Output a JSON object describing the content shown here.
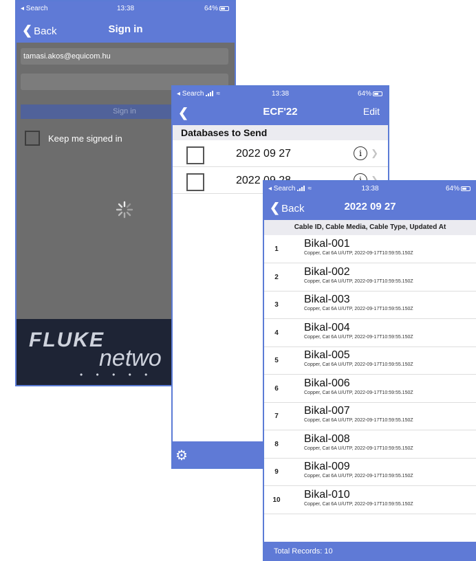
{
  "status": {
    "back": "◂ Search",
    "time": "13:38",
    "battery": "64%"
  },
  "signin": {
    "back": "Back",
    "title": "Sign in",
    "email": "tamasi.akos@equicom.hu",
    "password": "",
    "button": "Sign in",
    "keep": "Keep me signed in",
    "brand1": "FLUKE",
    "brand2": "netwo",
    "dots": "• • • • •"
  },
  "databases": {
    "title": "ECF'22",
    "edit": "Edit",
    "section": "Databases to Send",
    "rows": [
      {
        "name": "2022 09 27"
      },
      {
        "name": "2022 09 28"
      }
    ]
  },
  "records": {
    "back": "Back",
    "title": "2022 09 27",
    "header": "Cable ID, Cable Media, Cable Type, Updated At",
    "desc": "Copper, Cat 6A U/UTP, 2022-09-17T10:59:55.150Z",
    "items": [
      {
        "num": "1",
        "id": "Bikal-001"
      },
      {
        "num": "2",
        "id": "Bikal-002"
      },
      {
        "num": "3",
        "id": "Bikal-003"
      },
      {
        "num": "4",
        "id": "Bikal-004"
      },
      {
        "num": "5",
        "id": "Bikal-005"
      },
      {
        "num": "6",
        "id": "Bikal-006"
      },
      {
        "num": "7",
        "id": "Bikal-007"
      },
      {
        "num": "8",
        "id": "Bikal-008"
      },
      {
        "num": "9",
        "id": "Bikal-009"
      },
      {
        "num": "10",
        "id": "Bikal-010"
      }
    ],
    "total": "Total Records: 10"
  },
  "colors": {
    "accent": "#5f7ad6",
    "section": "#ebebf0"
  }
}
